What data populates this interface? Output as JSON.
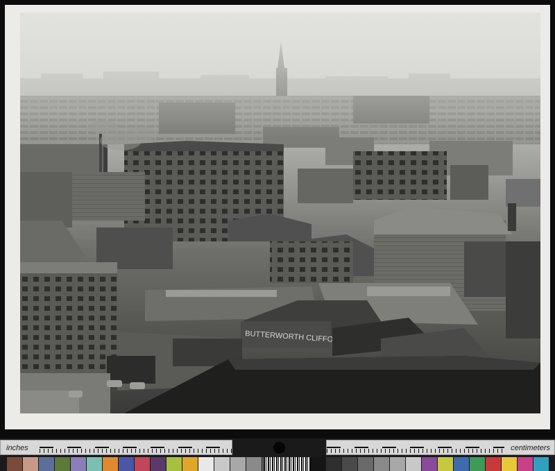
{
  "photo": {
    "alt": "Black and white aerial photograph of a city with factories, warehouses, chimneys, terraced housing and a church spire in the haze",
    "sign_text": "BUTTERWORTH CLIFFORD"
  },
  "color_target": {
    "left_label": "inches",
    "right_label": "centimeters",
    "swatch_colors": [
      "#7a4a3a",
      "#c79a88",
      "#5b6f9a",
      "#5c7a3a",
      "#8a7fb8",
      "#7bbfb2",
      "#e08a2f",
      "#4a57a8",
      "#c0475a",
      "#5a3a6a",
      "#a8c040",
      "#e0a62a",
      "#e8e8e8",
      "#c8c8c8",
      "#a8a8a8",
      "#8a8a8a",
      "#6a6a6a",
      "#4a4a4a",
      "#2f2f2f",
      "#151515",
      "#2f2f2f",
      "#4a4a4a",
      "#6a6a6a",
      "#8a8a8a",
      "#a8a8a8",
      "#c8c8c8",
      "#8a4a9a",
      "#c8c840",
      "#3f6ab0",
      "#3f9a5a",
      "#c83a3a",
      "#e8c83a",
      "#c8408a",
      "#30a0c0"
    ]
  }
}
